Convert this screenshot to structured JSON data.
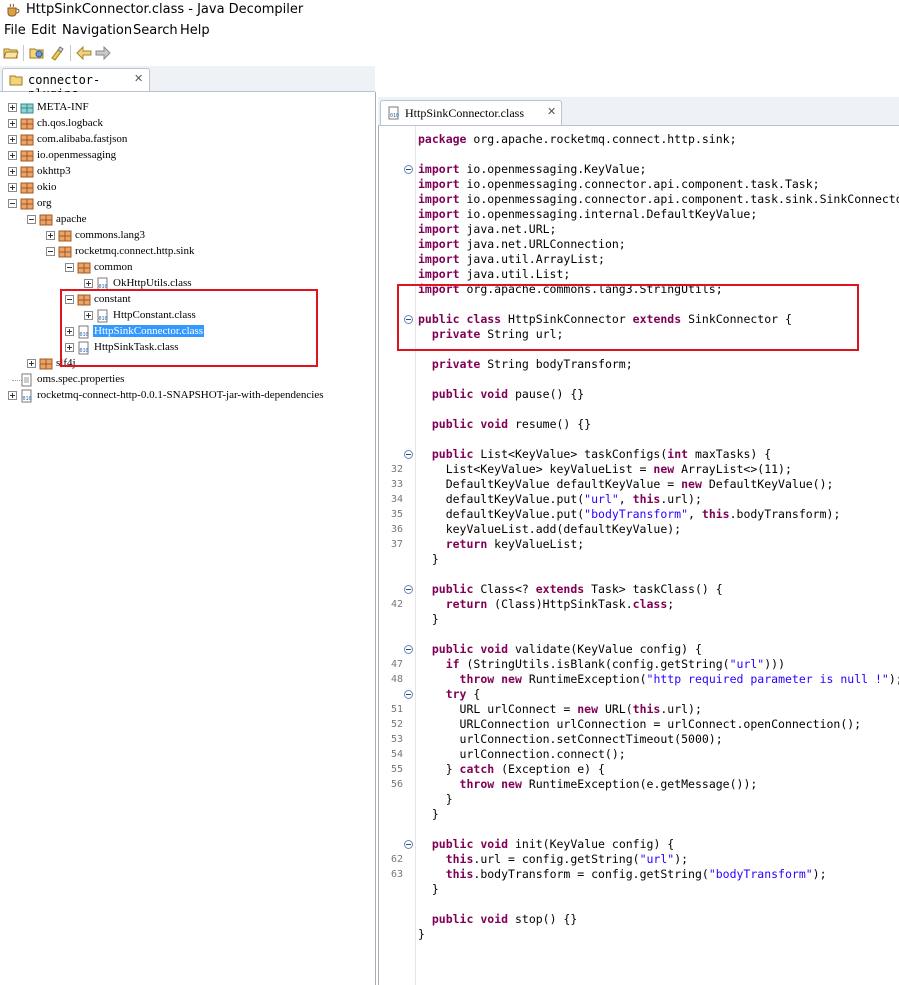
{
  "window": {
    "title": "HttpSinkConnector.class - Java Decompiler"
  },
  "menu": [
    "File",
    "Edit",
    "Navigation",
    "Search",
    "Help"
  ],
  "toolbar": {
    "icons": [
      "open-file-icon",
      "open-type-icon",
      "search-icon",
      "back-icon",
      "forward-icon"
    ]
  },
  "left_tab": {
    "label": "connector-plugins"
  },
  "tree": [
    {
      "label": "META-INF",
      "depth": 0,
      "icon": "folder-icon",
      "expanded": false
    },
    {
      "label": "ch.qos.logback",
      "depth": 0,
      "icon": "package-icon",
      "expanded": false
    },
    {
      "label": "com.alibaba.fastjson",
      "depth": 0,
      "icon": "package-icon",
      "expanded": false
    },
    {
      "label": "io.openmessaging",
      "depth": 0,
      "icon": "package-icon",
      "expanded": false
    },
    {
      "label": "okhttp3",
      "depth": 0,
      "icon": "package-icon",
      "expanded": false
    },
    {
      "label": "okio",
      "depth": 0,
      "icon": "package-icon",
      "expanded": false
    },
    {
      "label": "org",
      "depth": 0,
      "icon": "package-icon",
      "expanded": true
    },
    {
      "label": "apache",
      "depth": 1,
      "icon": "package-icon",
      "expanded": true
    },
    {
      "label": "commons.lang3",
      "depth": 2,
      "icon": "package-icon",
      "expanded": false
    },
    {
      "label": "rocketmq.connect.http.sink",
      "depth": 2,
      "icon": "package-icon",
      "expanded": true
    },
    {
      "label": "common",
      "depth": 3,
      "icon": "package-icon",
      "expanded": true
    },
    {
      "label": "OkHttpUtils.class",
      "depth": 4,
      "icon": "class-icon",
      "expanded": false
    },
    {
      "label": "constant",
      "depth": 3,
      "icon": "package-icon",
      "expanded": true
    },
    {
      "label": "HttpConstant.class",
      "depth": 4,
      "icon": "class-icon",
      "expanded": false
    },
    {
      "label": "HttpSinkConnector.class",
      "depth": 3,
      "icon": "class-icon",
      "expanded": false,
      "selected": true
    },
    {
      "label": "HttpSinkTask.class",
      "depth": 3,
      "icon": "class-icon",
      "expanded": false
    },
    {
      "label": "slf4j",
      "depth": 1,
      "icon": "package-icon",
      "expanded": false
    },
    {
      "label": "oms.spec.properties",
      "depth": 0,
      "icon": "file-icon",
      "expanded": null
    },
    {
      "label": "rocketmq-connect-http-0.0.1-SNAPSHOT-jar-with-dependencies",
      "depth": 0,
      "icon": "jar-icon",
      "expanded": false
    }
  ],
  "editor_tab": {
    "label": "HttpSinkConnector.class"
  },
  "code": [
    {
      "ln": "",
      "fold": false,
      "text": "package org.apache.rocketmq.connect.http.sink;"
    },
    {
      "ln": "",
      "fold": false,
      "text": ""
    },
    {
      "ln": "",
      "fold": true,
      "text": "import io.openmessaging.KeyValue;"
    },
    {
      "ln": "",
      "fold": false,
      "text": "import io.openmessaging.connector.api.component.task.Task;"
    },
    {
      "ln": "",
      "fold": false,
      "text": "import io.openmessaging.connector.api.component.task.sink.SinkConnector;"
    },
    {
      "ln": "",
      "fold": false,
      "text": "import io.openmessaging.internal.DefaultKeyValue;"
    },
    {
      "ln": "",
      "fold": false,
      "text": "import java.net.URL;"
    },
    {
      "ln": "",
      "fold": false,
      "text": "import java.net.URLConnection;"
    },
    {
      "ln": "",
      "fold": false,
      "text": "import java.util.ArrayList;"
    },
    {
      "ln": "",
      "fold": false,
      "text": "import java.util.List;"
    },
    {
      "ln": "",
      "fold": false,
      "text": "import org.apache.commons.lang3.StringUtils;"
    },
    {
      "ln": "",
      "fold": false,
      "text": ""
    },
    {
      "ln": "",
      "fold": true,
      "text": "public class HttpSinkConnector extends SinkConnector {"
    },
    {
      "ln": "",
      "fold": false,
      "text": "  private String url;"
    },
    {
      "ln": "",
      "fold": false,
      "text": ""
    },
    {
      "ln": "",
      "fold": false,
      "text": "  private String bodyTransform;"
    },
    {
      "ln": "",
      "fold": false,
      "text": ""
    },
    {
      "ln": "",
      "fold": false,
      "text": "  public void pause() {}"
    },
    {
      "ln": "",
      "fold": false,
      "text": ""
    },
    {
      "ln": "",
      "fold": false,
      "text": "  public void resume() {}"
    },
    {
      "ln": "",
      "fold": false,
      "text": ""
    },
    {
      "ln": "",
      "fold": true,
      "text": "  public List<KeyValue> taskConfigs(int maxTasks) {"
    },
    {
      "ln": "32",
      "fold": false,
      "text": "    List<KeyValue> keyValueList = new ArrayList<>(11);"
    },
    {
      "ln": "33",
      "fold": false,
      "text": "    DefaultKeyValue defaultKeyValue = new DefaultKeyValue();"
    },
    {
      "ln": "34",
      "fold": false,
      "text": "    defaultKeyValue.put(\"url\", this.url);"
    },
    {
      "ln": "35",
      "fold": false,
      "text": "    defaultKeyValue.put(\"bodyTransform\", this.bodyTransform);"
    },
    {
      "ln": "36",
      "fold": false,
      "text": "    keyValueList.add(defaultKeyValue);"
    },
    {
      "ln": "37",
      "fold": false,
      "text": "    return keyValueList;"
    },
    {
      "ln": "",
      "fold": false,
      "text": "  }"
    },
    {
      "ln": "",
      "fold": false,
      "text": ""
    },
    {
      "ln": "",
      "fold": true,
      "text": "  public Class<? extends Task> taskClass() {"
    },
    {
      "ln": "42",
      "fold": false,
      "text": "    return (Class)HttpSinkTask.class;"
    },
    {
      "ln": "",
      "fold": false,
      "text": "  }"
    },
    {
      "ln": "",
      "fold": false,
      "text": ""
    },
    {
      "ln": "",
      "fold": true,
      "text": "  public void validate(KeyValue config) {"
    },
    {
      "ln": "47",
      "fold": false,
      "text": "    if (StringUtils.isBlank(config.getString(\"url\")))"
    },
    {
      "ln": "48",
      "fold": false,
      "text": "      throw new RuntimeException(\"http required parameter is null !\");"
    },
    {
      "ln": "",
      "fold": true,
      "text": "    try {"
    },
    {
      "ln": "51",
      "fold": false,
      "text": "      URL urlConnect = new URL(this.url);"
    },
    {
      "ln": "52",
      "fold": false,
      "text": "      URLConnection urlConnection = urlConnect.openConnection();"
    },
    {
      "ln": "53",
      "fold": false,
      "text": "      urlConnection.setConnectTimeout(5000);"
    },
    {
      "ln": "54",
      "fold": false,
      "text": "      urlConnection.connect();"
    },
    {
      "ln": "55",
      "fold": false,
      "text": "    } catch (Exception e) {"
    },
    {
      "ln": "56",
      "fold": false,
      "text": "      throw new RuntimeException(e.getMessage());"
    },
    {
      "ln": "",
      "fold": false,
      "text": "    }"
    },
    {
      "ln": "",
      "fold": false,
      "text": "  }"
    },
    {
      "ln": "",
      "fold": false,
      "text": ""
    },
    {
      "ln": "",
      "fold": true,
      "text": "  public void init(KeyValue config) {"
    },
    {
      "ln": "62",
      "fold": false,
      "text": "    this.url = config.getString(\"url\");"
    },
    {
      "ln": "63",
      "fold": false,
      "text": "    this.bodyTransform = config.getString(\"bodyTransform\");"
    },
    {
      "ln": "",
      "fold": false,
      "text": "  }"
    },
    {
      "ln": "",
      "fold": false,
      "text": ""
    },
    {
      "ln": "",
      "fold": false,
      "text": "  public void stop() {}"
    },
    {
      "ln": "",
      "fold": false,
      "text": "}"
    }
  ],
  "colors": {
    "keyword": "#7f0055",
    "string": "#2a00ff",
    "selection": "#3399ff",
    "annotation_box": "#e0141e"
  }
}
